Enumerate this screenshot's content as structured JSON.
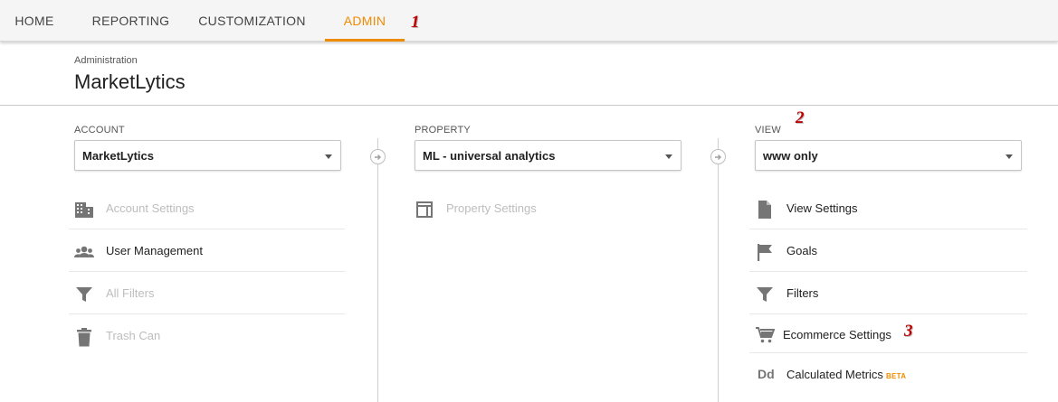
{
  "nav": {
    "tabs": [
      {
        "label": "HOME"
      },
      {
        "label": "REPORTING"
      },
      {
        "label": "CUSTOMIZATION"
      },
      {
        "label": "ADMIN",
        "active": true
      }
    ],
    "active_color": "#ef8b00"
  },
  "annotations": [
    "1",
    "2",
    "3"
  ],
  "header": {
    "breadcrumb": "Administration",
    "title": "MarketLytics"
  },
  "account": {
    "label": "ACCOUNT",
    "selected": "MarketLytics",
    "items": [
      {
        "label": "Account Settings",
        "icon": "building-icon",
        "enabled": false
      },
      {
        "label": "User Management",
        "icon": "users-icon",
        "enabled": true
      },
      {
        "label": "All Filters",
        "icon": "filter-icon",
        "enabled": false
      },
      {
        "label": "Trash Can",
        "icon": "trash-icon",
        "enabled": false
      }
    ]
  },
  "property": {
    "label": "PROPERTY",
    "selected": "ML - universal analytics",
    "items": [
      {
        "label": "Property Settings",
        "icon": "window-icon",
        "enabled": false
      }
    ]
  },
  "view": {
    "label": "VIEW",
    "selected": "www only",
    "items": [
      {
        "label": "View Settings",
        "icon": "document-icon",
        "enabled": true
      },
      {
        "label": "Goals",
        "icon": "flag-icon",
        "enabled": true
      },
      {
        "label": "Filters",
        "icon": "filter-icon",
        "enabled": true
      },
      {
        "label": "Ecommerce Settings",
        "icon": "cart-icon",
        "enabled": true
      },
      {
        "label": "Calculated Metrics",
        "icon": "dd-icon",
        "enabled": true,
        "badge": "BETA"
      }
    ]
  }
}
